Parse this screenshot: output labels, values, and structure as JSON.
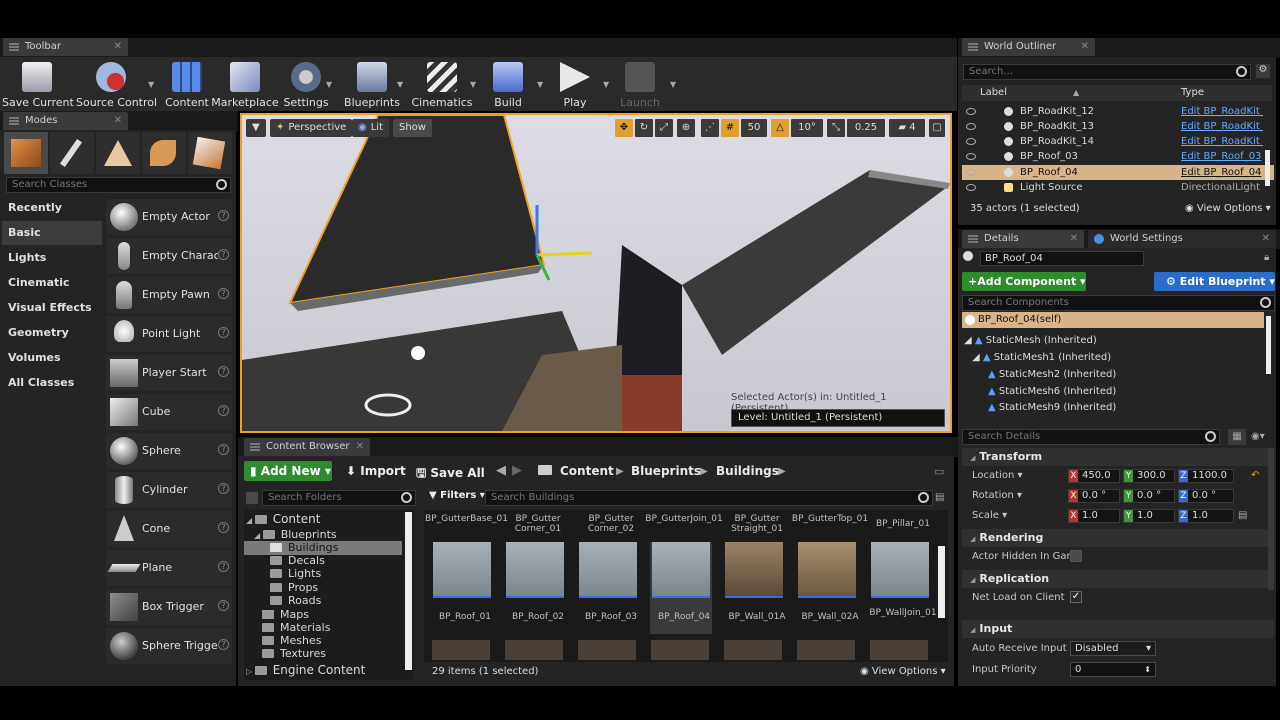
{
  "toolbar": {
    "tab_label": "Toolbar",
    "buttons": [
      {
        "label": "Save Current",
        "icon": "save-icon"
      },
      {
        "label": "Source Control",
        "icon": "source-control-icon"
      },
      {
        "label": "Content",
        "icon": "content-icon"
      },
      {
        "label": "Marketplace",
        "icon": "marketplace-icon"
      },
      {
        "label": "Settings",
        "icon": "settings-icon"
      },
      {
        "label": "Blueprints",
        "icon": "blueprints-icon"
      },
      {
        "label": "Cinematics",
        "icon": "cinematics-icon"
      },
      {
        "label": "Build",
        "icon": "build-icon"
      },
      {
        "label": "Play",
        "icon": "play-icon"
      },
      {
        "label": "Launch",
        "icon": "launch-icon"
      }
    ]
  },
  "modes": {
    "tab_label": "Modes",
    "search_placeholder": "Search Classes",
    "categories": [
      "Recently Placed",
      "Basic",
      "Lights",
      "Cinematic",
      "Visual Effects",
      "Geometry",
      "Volumes",
      "All Classes"
    ],
    "selected_category": "Basic",
    "actors": [
      "Empty Actor",
      "Empty Charac",
      "Empty Pawn",
      "Point Light",
      "Player Start",
      "Cube",
      "Sphere",
      "Cylinder",
      "Cone",
      "Plane",
      "Box Trigger",
      "Sphere Trigge"
    ]
  },
  "viewport": {
    "perspective": "Perspective",
    "lit": "Lit",
    "show": "Show",
    "grid_snap": "50",
    "rot_snap": "10°",
    "scale_snap": "0.25",
    "cam_speed": "4",
    "selected_actor_text": "Selected Actor(s) in:  Untitled_1 (Persistent)",
    "level_text": "Level:  Untitled_1 (Persistent)"
  },
  "outliner": {
    "tab_label": "World Outliner",
    "search_placeholder": "Search...",
    "col_label": "Label",
    "col_type": "Type",
    "rows": [
      {
        "label": "BP_RoadKit_12",
        "type": "Edit BP_RoadKit_",
        "selected": false,
        "link": true
      },
      {
        "label": "BP_RoadKit_13",
        "type": "Edit BP_RoadKit_",
        "selected": false,
        "link": true
      },
      {
        "label": "BP_RoadKit_14",
        "type": "Edit BP_RoadKit_",
        "selected": false,
        "link": true
      },
      {
        "label": "BP_Roof_03",
        "type": "Edit BP_Roof_03",
        "selected": false,
        "link": true
      },
      {
        "label": "BP_Roof_04",
        "type": "Edit BP_Roof_04",
        "selected": true,
        "link": true
      },
      {
        "label": "Light Source",
        "type": "DirectionalLight",
        "selected": false,
        "link": false
      }
    ],
    "actor_count": "35 actors (1 selected)",
    "view_options": "View Options"
  },
  "details": {
    "tab_label": "Details",
    "world_settings_label": "World Settings",
    "name_value": "BP_Roof_04",
    "add_component": "Add Component",
    "edit_blueprint": "Edit Blueprint",
    "search_components_placeholder": "Search Components",
    "self_item": "BP_Roof_04(self)",
    "components": [
      "StaticMesh (Inherited)",
      "StaticMesh1 (Inherited)",
      "StaticMesh2 (Inherited)",
      "StaticMesh6 (Inherited)",
      "StaticMesh9 (Inherited)"
    ],
    "search_details_placeholder": "Search Details",
    "sections": {
      "transform": "Transform",
      "rendering": "Rendering",
      "replication": "Replication",
      "input": "Input"
    },
    "transform": {
      "location_label": "Location",
      "rotation_label": "Rotation",
      "scale_label": "Scale",
      "location": [
        "450.0",
        "300.0",
        "1100.0"
      ],
      "rotation": [
        "0.0 °",
        "0.0 °",
        "0.0 °"
      ],
      "scale": [
        "1.0",
        "1.0",
        "1.0"
      ]
    },
    "actor_hidden_label": "Actor Hidden In Game",
    "net_load_label": "Net Load on Client",
    "auto_receive_label": "Auto Receive Input",
    "auto_receive_value": "Disabled",
    "input_priority_label": "Input Priority",
    "input_priority_value": "0"
  },
  "content_browser": {
    "tab_label": "Content Browser",
    "add_new": "Add New",
    "import": "Import",
    "save_all": "Save All",
    "breadcrumb": [
      "Content",
      "Blueprints",
      "Buildings"
    ],
    "search_folders_placeholder": "Search Folders",
    "filters": "Filters",
    "search_assets_placeholder": "Search Buildings",
    "folders": {
      "root": "Content",
      "blueprints": "Blueprints",
      "children": [
        "Buildings",
        "Decals",
        "Lights",
        "Props",
        "Roads"
      ],
      "others": [
        "Maps",
        "Materials",
        "Meshes",
        "Textures"
      ],
      "engine": "Engine Content"
    },
    "top_captions": [
      "BP_GutterBase_01",
      "BP_Gutter Corner_01",
      "BP_Gutter Corner_02",
      "BP_GutterJoin_01",
      "BP_Gutter Straight_01",
      "BP_GutterTop_01",
      "BP_Pillar_01"
    ],
    "assets": [
      "BP_Roof_01",
      "BP_Roof_02",
      "BP_Roof_03",
      "BP_Roof_04",
      "BP_Wall_01A",
      "BP_Wall_02A",
      "BP_WallJoin_01"
    ],
    "selected_asset": "BP_Roof_04",
    "item_count": "29 items (1 selected)",
    "view_options": "View Options"
  },
  "colors": {
    "accent_orange": "#f0a020",
    "selection": "#d8b48a",
    "add_green": "#2e8b2e",
    "edit_blue": "#2a6cc8"
  }
}
